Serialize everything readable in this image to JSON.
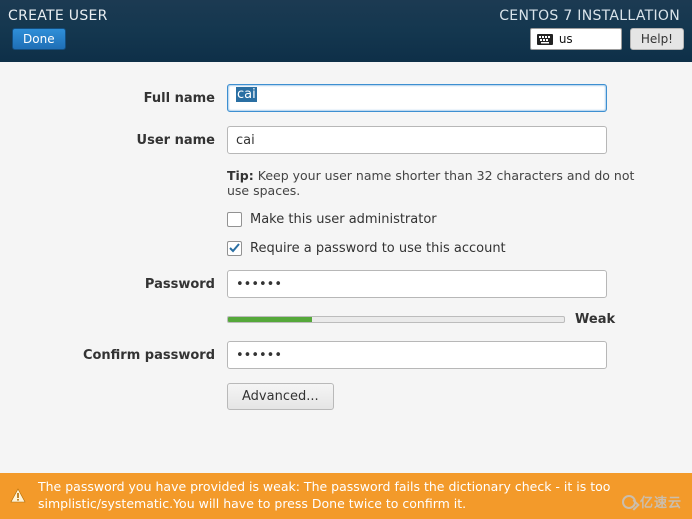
{
  "header": {
    "title": "CREATE USER",
    "product": "CENTOS 7 INSTALLATION",
    "done_label": "Done",
    "help_label": "Help!",
    "keyboard_layout": "us"
  },
  "form": {
    "fullname_label": "Full name",
    "fullname_value": "cai",
    "username_label": "User name",
    "username_value": "cai",
    "tip_prefix": "Tip:",
    "tip_text": " Keep your user name shorter than 32 characters and do not use spaces.",
    "make_admin_label": "Make this user administrator",
    "make_admin_checked": "false",
    "require_pw_label": "Require a password to use this account",
    "require_pw_checked": "true",
    "password_label": "Password",
    "password_value": "••••••",
    "confirm_label": "Confirm password",
    "confirm_value": "••••••",
    "strength_percent": "25",
    "strength_text": "Weak",
    "advanced_label": "Advanced..."
  },
  "warning": {
    "text": "The password you have provided is weak: The password fails the dictionary check - it is too simplistic/systematic.You will have to press Done twice to confirm it."
  },
  "watermark": "亿速云",
  "colors": {
    "header_bg": "#14374f",
    "accent_blue": "#2f8fd8",
    "warn_bg": "#f39a2a",
    "strength_green": "#55a83a"
  }
}
